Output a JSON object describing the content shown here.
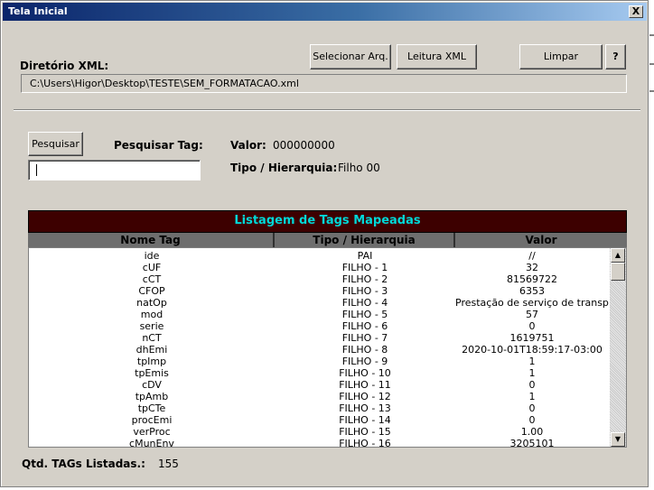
{
  "window": {
    "title": "Tela Inicial",
    "close_glyph": "X"
  },
  "toolbar": {
    "select_file": "Selecionar Arq.",
    "read_xml": "Leitura XML",
    "clear": "Limpar",
    "help": "?"
  },
  "directory": {
    "label": "Diretório XML:",
    "path": "C:\\Users\\Higor\\Desktop\\TESTE\\SEM_FORMATACAO.xml"
  },
  "search": {
    "button": "Pesquisar",
    "tag_label": "Pesquisar Tag:",
    "input_value": "",
    "value_label": "Valor:",
    "value": "000000000",
    "type_label": "Tipo / Hierarquia:",
    "type_value": "Filho 00"
  },
  "list": {
    "title": "Listagem de Tags Mapeadas",
    "columns": [
      "Nome Tag",
      "Tipo / Hierarquia",
      "Valor"
    ],
    "rows": [
      [
        "ide",
        "PAI",
        "//"
      ],
      [
        "cUF",
        "FILHO - 1",
        "32"
      ],
      [
        "cCT",
        "FILHO - 2",
        "81569722"
      ],
      [
        "CFOP",
        "FILHO - 3",
        "6353"
      ],
      [
        "natOp",
        "FILHO - 4",
        "Prestação de serviço de transporte"
      ],
      [
        "mod",
        "FILHO - 5",
        "57"
      ],
      [
        "serie",
        "FILHO - 6",
        "0"
      ],
      [
        "nCT",
        "FILHO - 7",
        "1619751"
      ],
      [
        "dhEmi",
        "FILHO - 8",
        "2020-10-01T18:59:17-03:00"
      ],
      [
        "tpImp",
        "FILHO - 9",
        "1"
      ],
      [
        "tpEmis",
        "FILHO - 10",
        "1"
      ],
      [
        "cDV",
        "FILHO - 11",
        "0"
      ],
      [
        "tpAmb",
        "FILHO - 12",
        "1"
      ],
      [
        "tpCTe",
        "FILHO - 13",
        "0"
      ],
      [
        "procEmi",
        "FILHO - 14",
        "0"
      ],
      [
        "verProc",
        "FILHO - 15",
        "1.00"
      ],
      [
        "cMunEnv",
        "FILHO - 16",
        "3205101"
      ]
    ]
  },
  "footer": {
    "count_label": "Qtd. TAGs Listadas.:",
    "count": "155"
  },
  "scrollbar": {
    "up_glyph": "▲",
    "down_glyph": "▼"
  }
}
